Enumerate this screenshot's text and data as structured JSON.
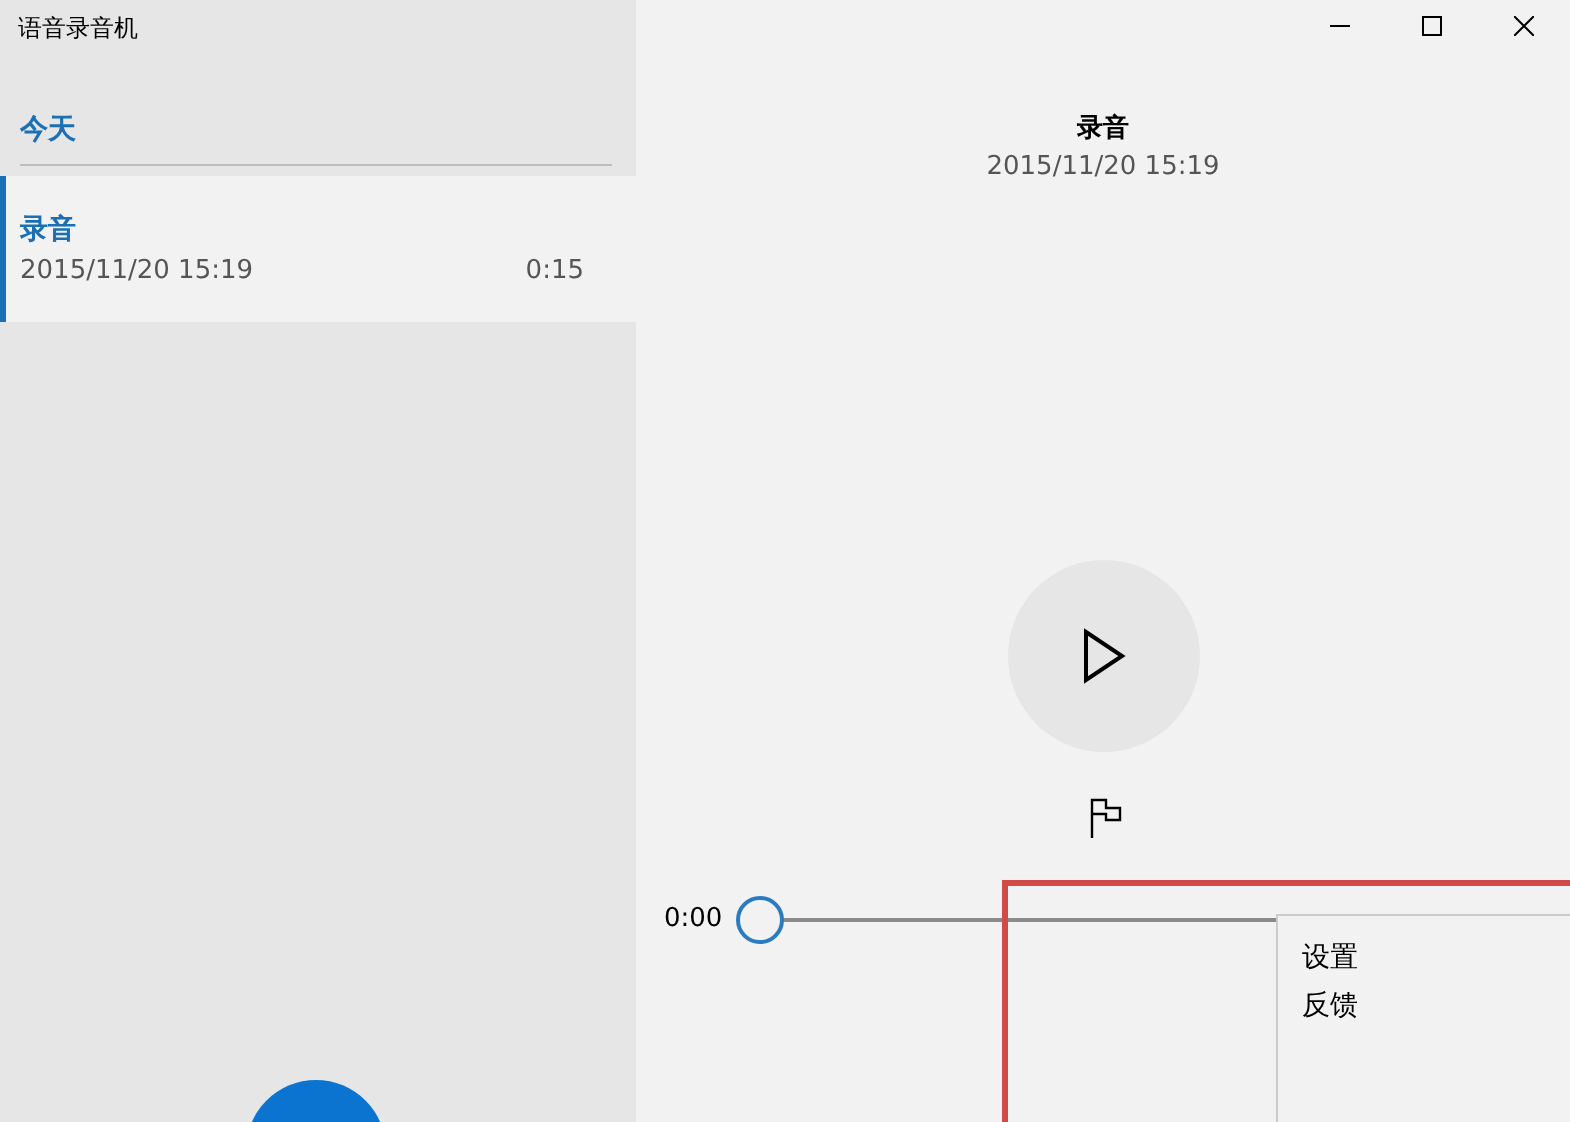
{
  "window": {
    "title": "语音录音机"
  },
  "sidebar": {
    "group": "今天",
    "items": [
      {
        "name": "录音",
        "date": "2015/11/20 15:19",
        "duration": "0:15",
        "selected": true
      }
    ]
  },
  "detail": {
    "title": "录音",
    "date": "2015/11/20 15:19",
    "position": "0:00",
    "level": 0
  },
  "menu": {
    "items": [
      "设置",
      "反馈"
    ]
  }
}
